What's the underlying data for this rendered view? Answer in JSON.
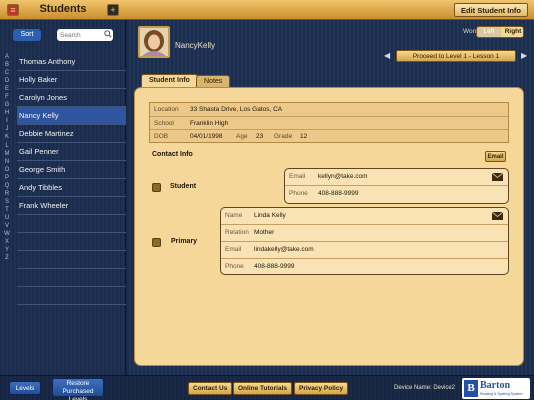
{
  "header": {
    "sidebar_title": "Students",
    "edit_button": "Edit Student Info"
  },
  "sidebar": {
    "sort_label": "Sort",
    "search_placeholder": "Search",
    "alphabet": [
      "A",
      "B",
      "C",
      "D",
      "E",
      "F",
      "G",
      "H",
      "I",
      "J",
      "K",
      "L",
      "M",
      "N",
      "O",
      "P",
      "Q",
      "R",
      "S",
      "T",
      "U",
      "V",
      "W",
      "X",
      "Y",
      "Z"
    ],
    "students": [
      "Thomas Anthony",
      "Holly Baker",
      "Carolyn Jones",
      "Nancy Kelly",
      "Debbie Martinez",
      "Gail Penner",
      "George Smith",
      "Andy Tibbles",
      "Frank Wheeler"
    ],
    "selected_index": 3
  },
  "student": {
    "name": "NancyKelly",
    "word_label": "Word",
    "hand_left": "Left",
    "hand_right": "Right",
    "hand_selected": "Right",
    "proceed_label": "Proceed to Level 1 - Lesson 1"
  },
  "tabs": {
    "info": "Student Info",
    "notes": "Notes",
    "active": "Student Info"
  },
  "info": {
    "location_label": "Location",
    "location": "33 Shasta Drive, Los Gatos, CA",
    "school_label": "School",
    "school": "Franklin High",
    "dob_label": "DOB",
    "dob": "04/01/1998",
    "age_label": "Age",
    "age": "23",
    "grade_label": "Grade",
    "grade": "12"
  },
  "contact": {
    "title": "Contact Info",
    "email_button": "Email",
    "student": {
      "label": "Student",
      "email_label": "Email",
      "email": "kellyn@take.com",
      "phone_label": "Phone",
      "phone": "408-888-9999"
    },
    "primary": {
      "label": "Primary",
      "name_label": "Name",
      "name": "Linda Kelly",
      "relation_label": "Relation",
      "relation": "Mother",
      "email_label": "Email",
      "email": "lindakelly@take.com",
      "phone_label": "Phone",
      "phone": "408-888-9999"
    }
  },
  "footer": {
    "levels": "Levels",
    "restore_1": "Restore",
    "restore_2": "Purchased Levels",
    "contact_us": "Contact Us",
    "tutorials": "Online Tutorials",
    "privacy": "Privacy Policy",
    "device": "Device Name: Device2",
    "logo_title": "Barton",
    "logo_sub": "Reading & Spelling System"
  },
  "colors": {
    "gold": "#f1c56c",
    "navy": "#1c2d4c",
    "card": "#f6d79a",
    "selected": "#2f55a0"
  }
}
